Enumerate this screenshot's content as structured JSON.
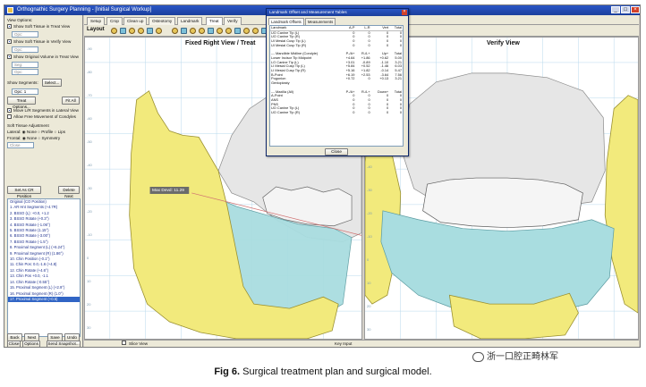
{
  "window": {
    "title": "Orthognathic Surgery Planning - [Initial Surgical Workup]"
  },
  "colors": {
    "bone_yellow": "#f2ea7c",
    "bone_white": "#e6e6e6",
    "soft_tissue_teal": "#a9dde0",
    "grid_line": "#b7d8ec",
    "accent_blue": "#1b3f9c"
  },
  "left_panel": {
    "view_options_label": "View Options:",
    "soft_tissue_treat": "Show Soft Tissue in Treat View",
    "soft_tissue_verify": "Show Soft Tissue in Verify View",
    "original_volume_treat": "Show Original Volume in Treat View",
    "show_segments_label": "Show Segments:",
    "select_button": "Select...",
    "opacity_label": "Opc:",
    "opacity_value": "1",
    "seg_label": "Seg:",
    "treat_options_button": "Treat Options...",
    "redo_button": "Fit All",
    "move_lr": "Move L/R Segments in Lateral View",
    "allow_free": "Allow Free Movement of Condyles",
    "soft_tissue_adjustment": "Soft Tissue Adjustment",
    "lateral_label": "Lateral:",
    "lateral_options": [
      "None",
      "Profile",
      "Lips"
    ],
    "frontal_label": "Frontal:",
    "frontal_options": [
      "None",
      "Symmetry"
    ],
    "close_dropdown": "Close",
    "set_cr_button": "Set As CR Position",
    "delete_button": "Delete Next",
    "plan_list": [
      "Original (CO Position)",
      "1. AR Hnt Segments (+4.7R)",
      "2. BSSO (L): +0.0, +1.2",
      "3. BSSO Rotate (+0.3°)",
      "4. BSSO Rotate (-1.06°)",
      "5. BSSO Rotate (1.15°)",
      "6. BSSO Rotate (-3.00°)",
      "7. BSSO Rotate (-1.5°)",
      "8. Proximal Segment (L) (+6.24°)",
      "9. Proximal Segment (R) (1.86°)",
      "10. Chin Position (-0.1°)",
      "11. Chin Pos: 0.0,-1.6 (+4.8)",
      "12. Chin Rotate (+4.6°)",
      "13. Chin Pos +0.0, -1.1",
      "14. Chin Rotate (-0.55°)",
      "15. Proximal Segment (L) (+2.9°)",
      "16. Proximal Segment (R) (1.0°)",
      "17. Proximal Segment (+0.5)"
    ],
    "bottom_buttons": [
      "Back",
      "Next",
      "Save",
      "Undo"
    ],
    "close_button": "Close",
    "options_button": "Options",
    "snapshot_button": "Send Snapshot..."
  },
  "tabs": [
    "Setup",
    "Crop",
    "Clean up",
    "Osteotomy",
    "Landmark",
    "Treat",
    "Verify"
  ],
  "active_tab": "Treat",
  "toolbar": {
    "layout_label": "Layout"
  },
  "viewports": {
    "left_title": "Fixed Right View / Treat",
    "right_title": "Verify View",
    "measure_label": "Max Devd: 11.29",
    "ruler_labels": [
      "-90",
      "-80",
      "-70",
      "-60",
      "-50",
      "-40",
      "-30",
      "-20",
      "-10",
      "0",
      "10",
      "20",
      "30"
    ]
  },
  "status_bar": {
    "slice_view": "Slice View",
    "key_input": "Key Input"
  },
  "dialog": {
    "title": "Landmark Offset and Measurement Tables",
    "tabs": [
      "Landmark Offsets",
      "Measurements"
    ],
    "columns": [
      "Landmark",
      "A-P",
      "L-R",
      "Vert",
      "Total"
    ],
    "rows": [
      [
        "UO Canine Tip (L)",
        "0",
        "0",
        "0",
        "0"
      ],
      [
        "UO Canine Tip (R)",
        "0",
        "0",
        "0",
        "0"
      ],
      [
        "UI Mesial Cusp Tip (L)",
        "0",
        "0",
        "0",
        "0"
      ],
      [
        "UI Mesial Cusp Tip (R)",
        "0",
        "0",
        "0",
        "0"
      ],
      [
        "",
        "",
        "",
        "",
        ""
      ],
      [
        "--- Mandible Midline (Condyle)",
        "P-/A+",
        "R-/L+",
        "Up+",
        "Total"
      ],
      [
        "Lower Incisor Tip Midpoint",
        "+4.64",
        "+1.86",
        "+0.62",
        "5.00"
      ],
      [
        "LO Canine Tip (L)",
        "+3.01",
        "-0.89",
        "-1.10",
        "3.21"
      ],
      [
        "LI Mesial Cusp Tip (L)",
        "+5.84",
        "+0.52",
        "-1.46",
        "6.03"
      ],
      [
        "LI Mesial Cusp Tip (R)",
        "+5.16",
        "+1.82",
        "-0.14",
        "5.47"
      ],
      [
        "B-Point",
        "+6.19",
        "+2.53",
        "-3.64",
        "7.56"
      ],
      [
        "Pogonion",
        "+0.72",
        "0",
        "+0.13",
        "3.21"
      ],
      [
        "Genioplasty",
        "",
        "",
        "",
        ""
      ],
      [
        "",
        "",
        "",
        "",
        ""
      ],
      [
        "--- Maxilla (All)",
        "P-/A+",
        "R-/L+",
        "Down+",
        "Total"
      ],
      [
        "A-Point",
        "0",
        "0",
        "0",
        "0"
      ],
      [
        "ANS",
        "0",
        "0",
        "0",
        "0"
      ],
      [
        "PNS",
        "0",
        "0",
        "0",
        "0"
      ],
      [
        "UO Canine Tip (L)",
        "0",
        "0",
        "0",
        "0"
      ],
      [
        "UO Canine Tip (R)",
        "0",
        "0",
        "0",
        "0"
      ]
    ],
    "close_button": "Close"
  },
  "caption": {
    "label": "Fig 6.",
    "text": "Surgical treatment plan and surgical model."
  },
  "watermark": {
    "text": "浙一口腔正畸林军"
  }
}
